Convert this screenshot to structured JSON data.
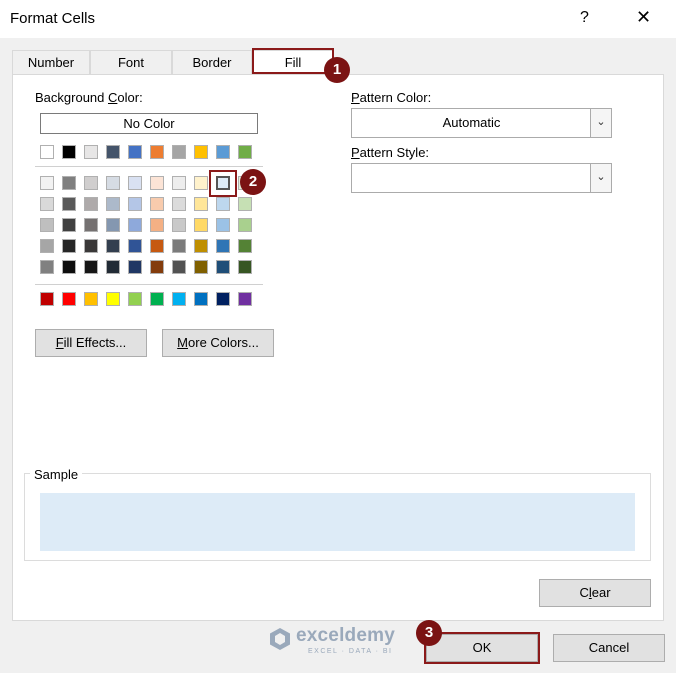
{
  "window": {
    "title": "Format Cells",
    "help": "?",
    "close": "✕"
  },
  "tabs": [
    "Number",
    "Font",
    "Border",
    "Fill"
  ],
  "active_tab": "Fill",
  "fill": {
    "background_color_label": "Background Color:",
    "no_color_label": "No Color",
    "fill_effects_label": "Fill Effects...",
    "more_colors_label": "More Colors...",
    "pattern_color_label": "Pattern Color:",
    "pattern_color_value": "Automatic",
    "pattern_style_label": "Pattern Style:",
    "pattern_style_value": ""
  },
  "palette": {
    "theme_row": [
      "#ffffff",
      "#000000",
      "#e7e6e6",
      "#44546a",
      "#4472c4",
      "#ed7d31",
      "#a5a5a5",
      "#ffc000",
      "#5b9bd5",
      "#70ad47"
    ],
    "tint_rows": [
      [
        "#f2f2f2",
        "#7f7f7f",
        "#d0cece",
        "#d6dce4",
        "#d9e1f2",
        "#fce4d6",
        "#ededed",
        "#fff2cc",
        "#ddebf7",
        "#e2efda"
      ],
      [
        "#d9d9d9",
        "#595959",
        "#aeaaaa",
        "#acb9ca",
        "#b4c6e7",
        "#f8cbad",
        "#dbdbdb",
        "#ffe699",
        "#bdd7ee",
        "#c6e0b4"
      ],
      [
        "#bfbfbf",
        "#404040",
        "#757171",
        "#8497b0",
        "#8ea9db",
        "#f4b084",
        "#c9c9c9",
        "#ffd966",
        "#9bc2e6",
        "#a9d08e"
      ],
      [
        "#a6a6a6",
        "#262626",
        "#3a3838",
        "#333f4f",
        "#305496",
        "#c65911",
        "#7b7b7b",
        "#bf8f00",
        "#2f75b5",
        "#548235"
      ],
      [
        "#808080",
        "#0d0d0d",
        "#161616",
        "#222b35",
        "#203764",
        "#833c0c",
        "#525252",
        "#806000",
        "#1f4e78",
        "#375623"
      ]
    ],
    "standard_row": [
      "#c00000",
      "#ff0000",
      "#ffc000",
      "#ffff00",
      "#92d050",
      "#00b050",
      "#00b0f0",
      "#0070c0",
      "#002060",
      "#7030a0"
    ],
    "selected_color": "#ddebf7"
  },
  "sample": {
    "label": "Sample",
    "color": "#ddebf7"
  },
  "buttons": {
    "clear": "Clear",
    "ok": "OK",
    "cancel": "Cancel"
  },
  "annotations": [
    "1",
    "2",
    "3"
  ],
  "watermark": {
    "name": "exceldemy",
    "tagline": "EXCEL · DATA · BI"
  }
}
